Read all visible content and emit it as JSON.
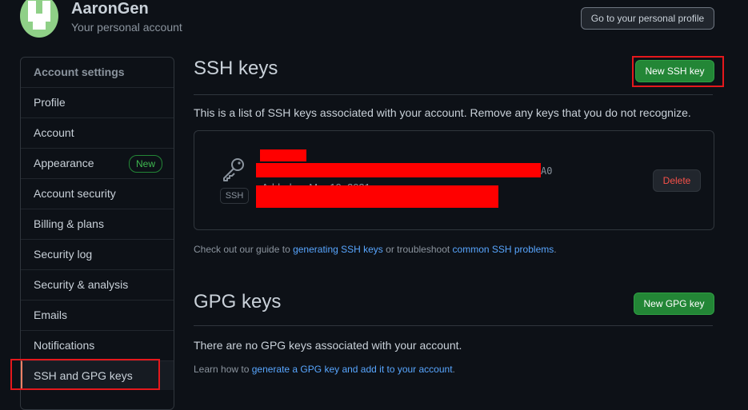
{
  "header": {
    "username": "AaronGen",
    "account_type": "Your personal account",
    "profile_button": "Go to your personal profile"
  },
  "sidebar": {
    "items": [
      {
        "label": "Account settings"
      },
      {
        "label": "Profile"
      },
      {
        "label": "Account"
      },
      {
        "label": "Appearance",
        "badge": "New"
      },
      {
        "label": "Account security"
      },
      {
        "label": "Billing & plans"
      },
      {
        "label": "Security log"
      },
      {
        "label": "Security & analysis"
      },
      {
        "label": "Emails"
      },
      {
        "label": "Notifications"
      },
      {
        "label": "SSH and GPG keys"
      }
    ]
  },
  "ssh": {
    "title": "SSH keys",
    "new_button": "New SSH key",
    "description": "This is a list of SSH keys associated with your account. Remove any keys that you do not recognize.",
    "key": {
      "type_badge": "SSH",
      "fingerprint_tail": "A0",
      "added_partial": "Added on Mar 10, 2021",
      "delete_button": "Delete",
      "icon": "key-icon"
    },
    "help_prefix": "Check out our guide to ",
    "help_link1": "generating SSH keys",
    "help_middle": " or troubleshoot ",
    "help_link2": "common SSH problems",
    "help_suffix": "."
  },
  "gpg": {
    "title": "GPG keys",
    "new_button": "New GPG key",
    "description": "There are no GPG keys associated with your account.",
    "help_prefix": "Learn how to ",
    "help_link": "generate a GPG key and add it to your account",
    "help_suffix": "."
  },
  "colors": {
    "background": "#0d1117",
    "accent_green": "#238636",
    "link": "#58a6ff",
    "danger": "#f85149",
    "highlight_box": "#e5181c",
    "redaction": "#ff0000"
  }
}
